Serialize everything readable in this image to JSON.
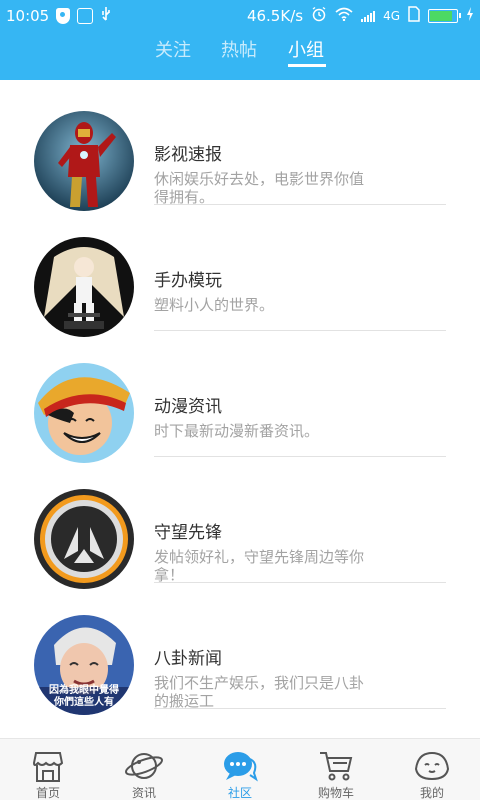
{
  "status": {
    "time": "10:05",
    "speed": "46.5K/s",
    "network": "4G"
  },
  "tabs": [
    {
      "label": "关注"
    },
    {
      "label": "热帖"
    },
    {
      "label": "小组"
    }
  ],
  "groups": [
    {
      "title": "影视速报",
      "desc": "休闲娱乐好去处，电影世界你值得拥有。",
      "avatar": "iron-man"
    },
    {
      "title": "手办模玩",
      "desc": "塑料小人的世界。",
      "avatar": "anime-figure"
    },
    {
      "title": "动漫资讯",
      "desc": "时下最新动漫新番资讯。",
      "avatar": "luffy"
    },
    {
      "title": "守望先锋",
      "desc": "发帖领好礼，守望先锋周边等你拿！",
      "avatar": "overwatch-logo"
    },
    {
      "title": "八卦新闻",
      "desc": "我们不生产娱乐，我们只是八卦的搬运工",
      "avatar": "meme-face",
      "avatar_caption": "因為我眼中覺得 你們這些人有"
    }
  ],
  "bottom_nav": [
    {
      "label": "首页",
      "icon": "home-icon"
    },
    {
      "label": "资讯",
      "icon": "planet-icon"
    },
    {
      "label": "社区",
      "icon": "chat-icon",
      "active": true
    },
    {
      "label": "购物车",
      "icon": "cart-icon"
    },
    {
      "label": "我的",
      "icon": "face-icon"
    }
  ],
  "colors": {
    "header": "#36b6f3",
    "active_nav": "#2b9de8"
  }
}
